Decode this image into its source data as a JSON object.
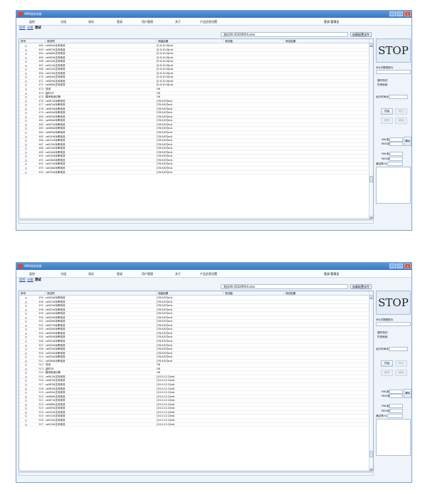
{
  "app_title": "WMI测试系统",
  "menu": [
    "监控",
    "分组",
    "测试",
    "登录",
    "用户管理",
    "关于",
    "产品信息设置"
  ],
  "login_status": "登录:管理员",
  "tabs": [
    "监控",
    "分组",
    "测试"
  ],
  "file_name": "测试36-20220914.xlsx",
  "load_button": "加载配置文件",
  "columns": [
    "序号",
    "测试项",
    "测量结果",
    "测试值",
    "测试结果"
  ],
  "stop_label": "STOP",
  "sn_label": "SN(字数限制3)",
  "mode_options": [
    "循环测试",
    "失败继续"
  ],
  "run_time_label": "运行时间(秒)",
  "start_button": "开始",
  "stop_button": "停止",
  "pause_button": "暂停",
  "continue_button": "继续",
  "pass_fail_group": "PASS数",
  "fail_group_label": "FAIL数",
  "pass_count_label": "PASS数",
  "reset_button": "清除",
  "fail_board_label": "FAIL板",
  "pass_board_label": "PASS板",
  "pass_rate_label": "通过率(%)",
  "window1": {
    "rows": [
      {
        "num": "462",
        "item": "cell04#正向电流",
        "result": "[0.0;10.0]mA"
      },
      {
        "num": "463",
        "item": "cell07#正向电流",
        "result": "[0.0;10.0]mA"
      },
      {
        "num": "464",
        "item": "cell08#正向电流",
        "result": "[0.0;10.0]mA"
      },
      {
        "num": "465",
        "item": "cell09#正向电流",
        "result": "[0.0;10.0]mA"
      },
      {
        "num": "466",
        "item": "cell10#正向电流",
        "result": "[0.0;10.0]mA"
      },
      {
        "num": "467",
        "item": "cell11#正向电流",
        "result": "[0.0;10.0]mA"
      },
      {
        "num": "468",
        "item": "cell12#正向电流",
        "result": "[0.0;10.0]mA"
      },
      {
        "num": "469",
        "item": "cell13#正向电流",
        "result": "[0.0;10.0]mA"
      },
      {
        "num": "470",
        "item": "cell04#正向电流",
        "result": "[0.0;10.0]mA"
      },
      {
        "num": "471",
        "item": "cell05#正向电流",
        "result": "[0.0;10.0]mA"
      },
      {
        "num": "472",
        "item": "cell06#正向电流",
        "result": "[0.0;10.0]mA"
      },
      {
        "num": "473",
        "item": "关闭",
        "result": "OK"
      },
      {
        "num": "474",
        "item": "延时15",
        "result": "OK"
      },
      {
        "num": "475",
        "item": "模块电池切换",
        "result": "OK"
      },
      {
        "num": "476",
        "item": "cell01#功率电流",
        "result": "[78.5;87]mA"
      },
      {
        "num": "477",
        "item": "cell02#功率电流",
        "result": "[78.5;87]mA"
      },
      {
        "num": "478",
        "item": "cell03#功率电流",
        "result": "[78.5;87]mA"
      },
      {
        "num": "479",
        "item": "cell04#功率电流",
        "result": "[78.5;87]mA"
      },
      {
        "num": "480",
        "item": "cell05#功率电流",
        "result": "[78.5;87]mA"
      },
      {
        "num": "481",
        "item": "cell06#功率电流",
        "result": "[78.5;87]mA"
      },
      {
        "num": "482",
        "item": "cell07#功率电流",
        "result": "[78.5;87]mA"
      },
      {
        "num": "483",
        "item": "cell08#功率电流",
        "result": "[78.5;87]mA"
      },
      {
        "num": "484",
        "item": "cell09#功率电流",
        "result": "[78.5;87]mA"
      },
      {
        "num": "485",
        "item": "cell10#功率电流",
        "result": "[78.5;87]mA"
      },
      {
        "num": "486",
        "item": "cell11#功率电流",
        "result": "[78.5;87]mA"
      },
      {
        "num": "487",
        "item": "cell12#功率电流",
        "result": "[78.5;87]mA"
      },
      {
        "num": "488",
        "item": "cell13#功率电流",
        "result": "[78.5;87]mA"
      },
      {
        "num": "489",
        "item": "cell14#功率电流",
        "result": "[78.5;87]mA"
      },
      {
        "num": "490",
        "item": "cell15#功率电流",
        "result": "[78.5;87]mA"
      },
      {
        "num": "491",
        "item": "cell16#功率电流",
        "result": "[78.5;87]mA"
      },
      {
        "num": "492",
        "item": "cell17#功率电流",
        "result": "[78.5;87]mA"
      },
      {
        "num": "493",
        "item": "cell18#功率电流",
        "result": "[78.5;87]mA"
      },
      {
        "num": "494",
        "item": "cell19#功率电流",
        "result": "[78.5;87]mA"
      }
    ]
  },
  "window2": {
    "rows": [
      {
        "num": "495",
        "item": "cell20#功率电流",
        "result": "[78.5;87]mA"
      },
      {
        "num": "496",
        "item": "cell21#功率电流",
        "result": "[78.5;87]mA"
      },
      {
        "num": "497",
        "item": "cell22#功率电流",
        "result": "[78.5;87]mA"
      },
      {
        "num": "498",
        "item": "cell23#功率电流",
        "result": "[78.5;87]mA"
      },
      {
        "num": "499",
        "item": "cell24#功率电流",
        "result": "[78.5;87]mA"
      },
      {
        "num": "500",
        "item": "cell25#功率电流",
        "result": "[78.5;87]mA"
      },
      {
        "num": "501",
        "item": "cell26#功率电流",
        "result": "[78.5;87]mA"
      },
      {
        "num": "502",
        "item": "cell27#功率电流",
        "result": "[78.5;87]mA"
      },
      {
        "num": "503",
        "item": "cell28#功率电流",
        "result": "[78.5;87]mA"
      },
      {
        "num": "504",
        "item": "cell29#功率电流",
        "result": "[78.5;87]mA"
      },
      {
        "num": "505",
        "item": "cell30#功率电流",
        "result": "[78.5;87]mA"
      },
      {
        "num": "506",
        "item": "cell31#功率电流",
        "result": "[78.5;87]mA"
      },
      {
        "num": "507",
        "item": "cell32#功率电流",
        "result": "[78.5;87]mA"
      },
      {
        "num": "508",
        "item": "cell33#功率电流",
        "result": "[78.5;87]mA"
      },
      {
        "num": "509",
        "item": "cell34#功率电流",
        "result": "[78.5;87]mA"
      },
      {
        "num": "510",
        "item": "cell35#功率电流",
        "result": "[78.5;87]mA"
      },
      {
        "num": "511",
        "item": "cell36#功率电流",
        "result": "[78.5;87]mA"
      },
      {
        "num": "512",
        "item": "关闭",
        "result": "OK"
      },
      {
        "num": "513",
        "item": "延时15",
        "result": "OK"
      },
      {
        "num": "514",
        "item": "模块电池切换",
        "result": "OK"
      },
      {
        "num": "515",
        "item": "cell01#正向电流",
        "result": "[10.2;12.2]mA"
      },
      {
        "num": "516",
        "item": "cell02#正向电流",
        "result": "[10.2;12.2]mA"
      },
      {
        "num": "517",
        "item": "cell03#正向电流",
        "result": "[10.2;12.2]mA"
      },
      {
        "num": "518",
        "item": "cell04#正向电流",
        "result": "[10.2;12.2]mA"
      },
      {
        "num": "519",
        "item": "cell05#正向电流",
        "result": "[10.2;12.2]mA"
      },
      {
        "num": "520",
        "item": "cell06#正向电流",
        "result": "[10.2;12.2]mA"
      },
      {
        "num": "521",
        "item": "cell07#正向电流",
        "result": "[10.2;12.2]mA"
      },
      {
        "num": "522",
        "item": "cell08#正向电流",
        "result": "[10.2;12.2]mA"
      },
      {
        "num": "523",
        "item": "cell09#正向电流",
        "result": "[10.2;12.2]mA"
      },
      {
        "num": "524",
        "item": "cell10#正向电流",
        "result": "[10.2;12.2]mA"
      },
      {
        "num": "525",
        "item": "cell11#正向电流",
        "result": "[10.2;12.2]mA"
      },
      {
        "num": "526",
        "item": "cell12#正向电流",
        "result": "[10.2;12.2]mA"
      },
      {
        "num": "527",
        "item": "cell13#正向电流",
        "result": "[10.2;12.2]mA"
      }
    ]
  }
}
